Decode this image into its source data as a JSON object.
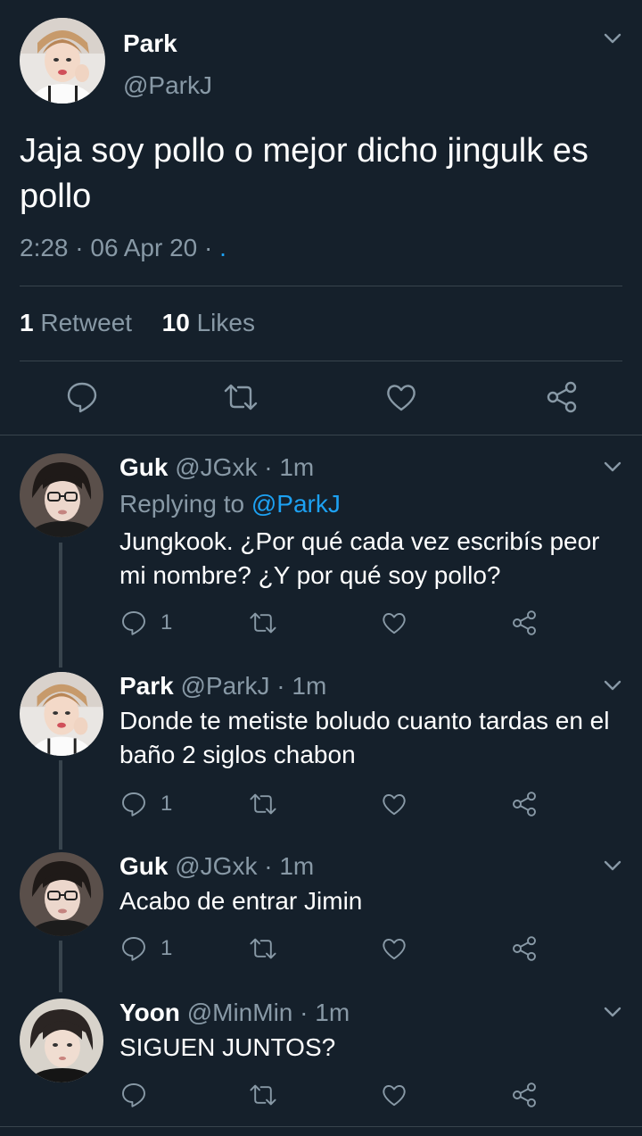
{
  "main_tweet": {
    "name": "Park",
    "handle": "@ParkJ",
    "text": "Jaja soy pollo o mejor dicho jingulk es pollo",
    "meta": "2:28 · 06 Apr 20 · ",
    "meta_link": ".",
    "retweets_count": "1",
    "retweets_label": "Retweet",
    "likes_count": "10",
    "likes_label": "Likes"
  },
  "replies": [
    {
      "name": "Guk",
      "handle": "@JGxk",
      "time": "· 1m",
      "replying_prefix": "Replying to",
      "replying_to": "@ParkJ",
      "text": "Jungkook. ¿Por qué cada vez escribís peor mi nombre? ¿Y por qué soy pollo?",
      "reply_count": "1"
    },
    {
      "name": "Park",
      "handle": "@ParkJ",
      "time": "· 1m",
      "text": "Donde te metiste boludo cuanto tardas en el baño 2 siglos chabon",
      "reply_count": "1"
    },
    {
      "name": "Guk",
      "handle": "@JGxk",
      "time": "· 1m",
      "text": "Acabo de entrar Jimin",
      "reply_count": "1"
    },
    {
      "name": "Yoon",
      "handle": "@MinMin",
      "time": "· 1m",
      "text": "SIGUEN JUNTOS?",
      "reply_count": ""
    }
  ],
  "icons": {
    "reply": "speech-bubble-icon",
    "retweet": "retweet-arrows-icon",
    "like": "heart-icon",
    "share": "share-nodes-icon",
    "menu": "chevron-down-icon"
  },
  "colors": {
    "background": "#15202b",
    "text": "#ffffff",
    "muted": "#8899a6",
    "link": "#1da1f2",
    "divider": "#38444d"
  }
}
